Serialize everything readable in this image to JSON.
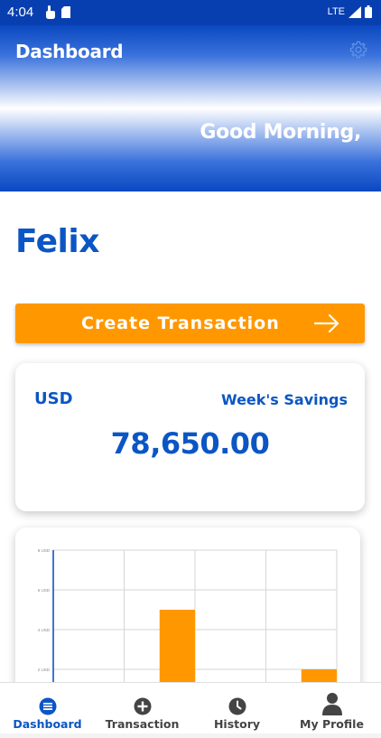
{
  "status_bar": {
    "time": "4:04",
    "network": "LTE"
  },
  "header": {
    "title": "Dashboard",
    "greeting": "Good Morning,",
    "settings_icon": "gear-icon"
  },
  "user": {
    "name": "Felix"
  },
  "create_transaction": {
    "label": "Create Transaction",
    "icon": "arrow-right-icon"
  },
  "savings_card": {
    "currency": "USD",
    "label": "Week's Savings",
    "amount": "78,650.00"
  },
  "colors": {
    "primary_blue": "#0b56c4",
    "accent_orange": "#ff9800",
    "header_blue": "#0a48c0"
  },
  "chart_data": {
    "type": "bar",
    "y_tick_labels": [
      "8 USD",
      "6 USD",
      "4 USD",
      "2 USD"
    ],
    "y_ticks": [
      8,
      6,
      4,
      2
    ],
    "ylim": [
      0,
      8
    ],
    "bar_slots": 4,
    "values": [
      0,
      5,
      0,
      2
    ],
    "bar_color": "#ff9800",
    "grid": true
  },
  "bottom_nav": {
    "items": [
      {
        "label": "Dashboard",
        "icon": "list-circle-icon",
        "active": true
      },
      {
        "label": "Transaction",
        "icon": "plus-circle-icon",
        "active": false
      },
      {
        "label": "History",
        "icon": "clock-icon",
        "active": false
      },
      {
        "label": "My Profile",
        "icon": "person-icon",
        "active": false
      }
    ]
  }
}
